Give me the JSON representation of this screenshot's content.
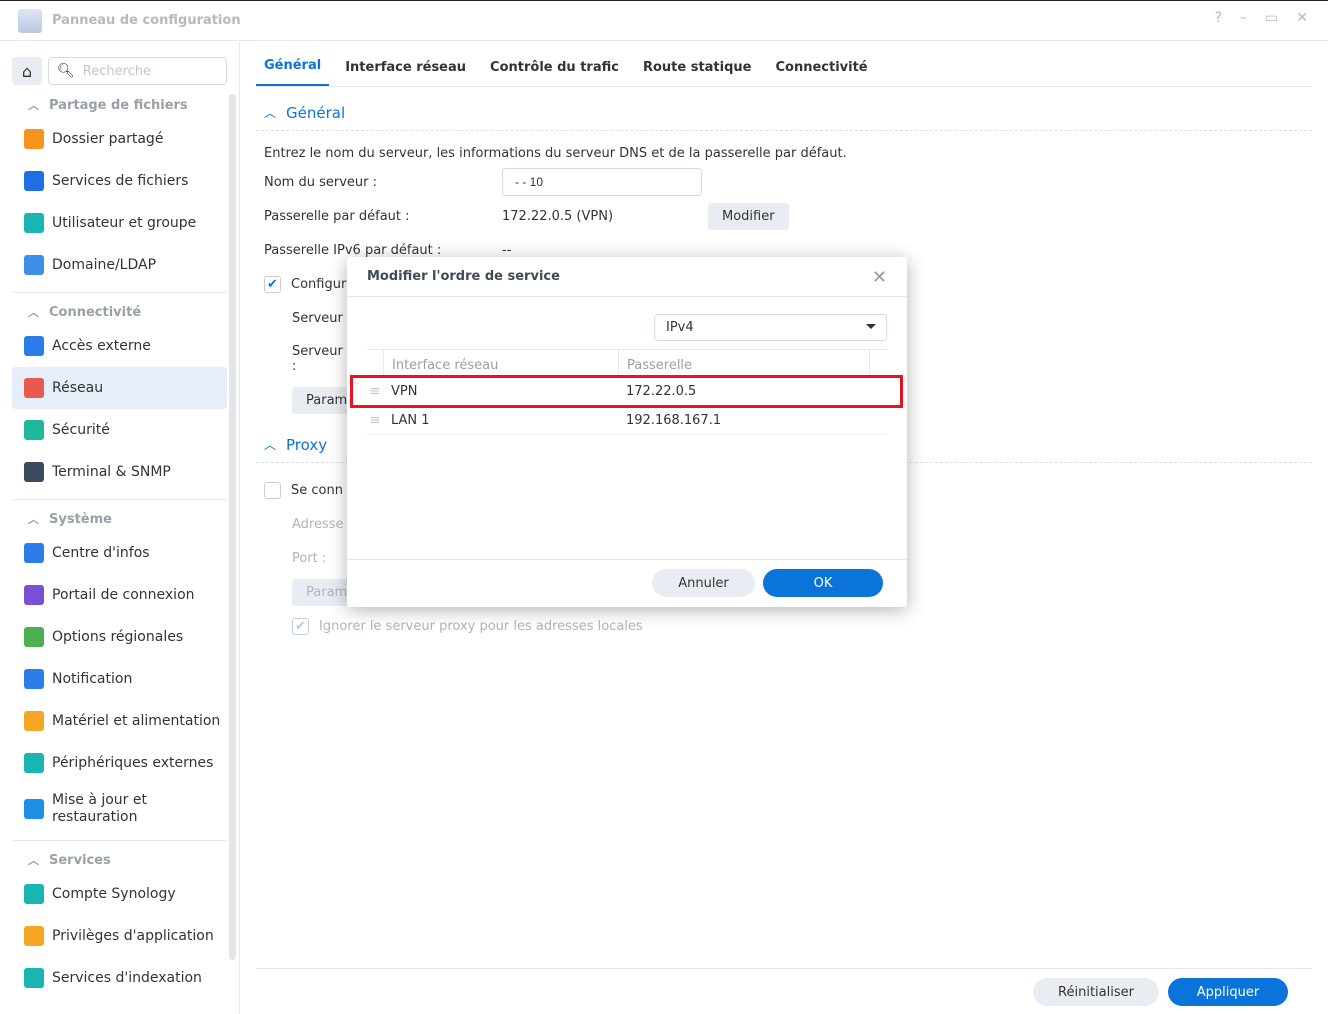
{
  "window": {
    "title": "Panneau de configuration",
    "controls": [
      "?",
      "–",
      "▭",
      "✕"
    ]
  },
  "sidebar": {
    "search_placeholder": "Recherche",
    "sections": [
      {
        "label": "Partage de fichiers",
        "items": [
          {
            "label": "Dossier partagé",
            "color": "#f7931e"
          },
          {
            "label": "Services de fichiers",
            "color": "#1e6fe6"
          },
          {
            "label": "Utilisateur et groupe",
            "color": "#19b5b0"
          },
          {
            "label": "Domaine/LDAP",
            "color": "#3d8fe8"
          }
        ]
      },
      {
        "label": "Connectivité",
        "items": [
          {
            "label": "Accès externe",
            "color": "#2b7de9"
          },
          {
            "label": "Réseau",
            "color": "#e85a4f",
            "active": true
          },
          {
            "label": "Sécurité",
            "color": "#1fb89b"
          },
          {
            "label": "Terminal & SNMP",
            "color": "#3b4a5e"
          }
        ]
      },
      {
        "label": "Système",
        "items": [
          {
            "label": "Centre d'infos",
            "color": "#2b7de9"
          },
          {
            "label": "Portail de connexion",
            "color": "#7a4fd6"
          },
          {
            "label": "Options régionales",
            "color": "#4caf50"
          },
          {
            "label": "Notification",
            "color": "#2b7de9"
          },
          {
            "label": "Matériel et alimentation",
            "color": "#f5a623"
          },
          {
            "label": "Périphériques externes",
            "color": "#19b5b0"
          },
          {
            "label": "Mise à jour et restauration",
            "color": "#1e8fe6"
          }
        ]
      },
      {
        "label": "Services",
        "items": [
          {
            "label": "Compte Synology",
            "color": "#19b5b0"
          },
          {
            "label": "Privilèges d'application",
            "color": "#f5a623"
          },
          {
            "label": "Services d'indexation",
            "color": "#19b5b0"
          }
        ]
      }
    ]
  },
  "tabs": [
    "Général",
    "Interface réseau",
    "Contrôle du trafic",
    "Route statique",
    "Connectivité"
  ],
  "general": {
    "heading": "Général",
    "description": "Entrez le nom du serveur, les informations du serveur DNS et de la passerelle par défaut.",
    "server_name_label": "Nom du serveur :",
    "server_name_value": "- - 10",
    "gateway_label": "Passerelle par défaut :",
    "gateway_value": "172.22.0.5 (VPN)",
    "modify_button": "Modifier",
    "ipv6_label": "Passerelle IPv6 par défaut :",
    "ipv6_value": "--",
    "dns_checkbox": "Configur",
    "dns_server1": "Serveur",
    "dns_server2": "Serveur",
    "colon": ":",
    "param_button": "Param"
  },
  "proxy": {
    "heading": "Proxy",
    "connect_checkbox": "Se conn",
    "address_label": "Adresse",
    "port_label": "Port :",
    "param_button": "Param",
    "bypass_checkbox": "Ignorer le serveur proxy pour les adresses locales"
  },
  "footer": {
    "reset": "Réinitialiser",
    "apply": "Appliquer"
  },
  "dialog": {
    "title": "Modifier l'ordre de service",
    "protocol": "IPv4",
    "columns": [
      "Interface réseau",
      "Passerelle"
    ],
    "rows": [
      {
        "interface": "VPN",
        "gateway": "172.22.0.5",
        "highlighted": true
      },
      {
        "interface": "LAN 1",
        "gateway": "192.168.167.1"
      }
    ],
    "cancel": "Annuler",
    "ok": "OK"
  },
  "colors": {
    "accent": "#0a74da",
    "highlight": "#e8131f"
  }
}
